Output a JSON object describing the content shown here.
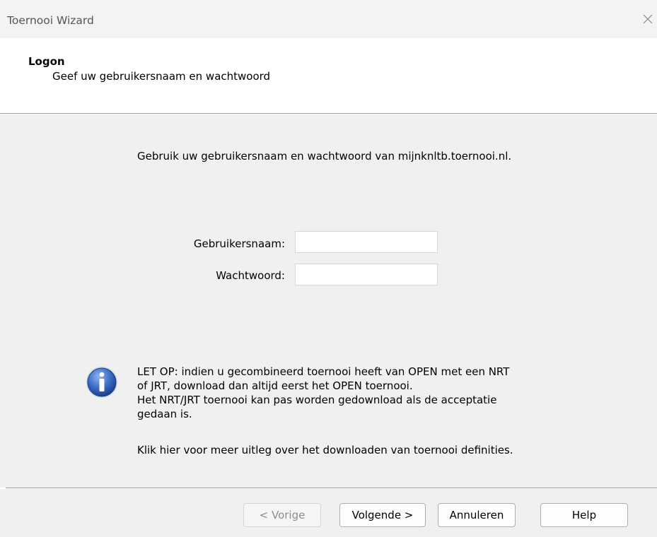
{
  "window": {
    "title": "Toernooi Wizard",
    "close_icon": "close-icon"
  },
  "header": {
    "title": "Logon",
    "subtitle": "Geef uw gebruikersnaam en wachtwoord"
  },
  "main": {
    "intro": "Gebruik uw gebruikersnaam en wachtwoord van mijnknltb.toernooi.nl.",
    "username_label": "Gebruikersnaam:",
    "username_value": "",
    "password_label": "Wachtwoord:",
    "password_value": "",
    "info_icon": "info-icon",
    "note_lines": [
      "LET OP: indien u gecombineerd toernooi heeft van OPEN met een NRT",
      "of JRT, download dan altijd eerst het OPEN toernooi.",
      "Het NRT/JRT toernooi kan pas worden gedownload als de acceptatie",
      "gedaan is."
    ],
    "more_link": "Klik hier voor meer uitleg over het downloaden van toernooi definities."
  },
  "footer": {
    "prev_label": "< Vorige",
    "next_label": "Volgende >",
    "cancel_label": "Annuleren",
    "help_label": "Help"
  },
  "colors": {
    "dialog_bg": "#f0f0f0",
    "header_bg": "#ffffff",
    "info_icon_blue": "#2e5fb8"
  }
}
